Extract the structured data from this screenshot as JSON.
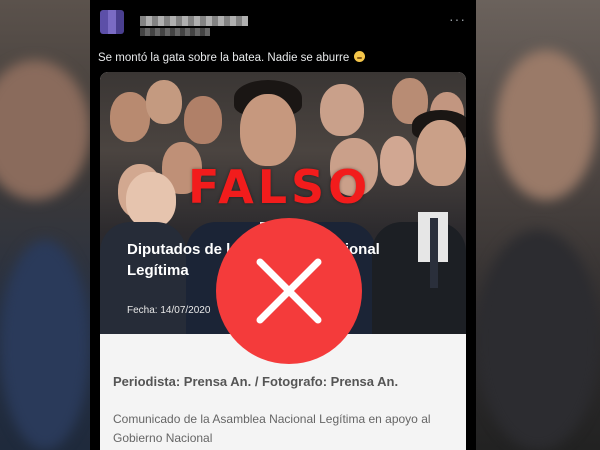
{
  "post": {
    "text": "Se montó la gata sobre la batea. Nadie se aburre",
    "emoji_icon": "flushed-face-emoji",
    "more_icon": "···"
  },
  "image": {
    "overlay_label": "FALSO",
    "title_line1": "Diputados de la Asamblea Nacional",
    "title_line2": "Legítima",
    "date": "Fecha: 14/07/2020",
    "verdict_icon": "x-mark-icon",
    "verdict_color": "#f43b3b",
    "label_color": "#f21c1c"
  },
  "article": {
    "byline": "Periodista: Prensa An. / Fotografo: Prensa An.",
    "blurb": "Comunicado de la Asamblea Nacional Legítima en apoyo al Gobierno Nacional"
  }
}
